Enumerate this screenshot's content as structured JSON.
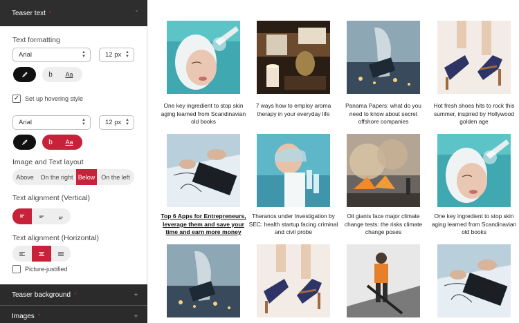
{
  "sidebar": {
    "teaser_text": {
      "title": "Teaser text",
      "required_mark": "*",
      "toggle": "ˇ"
    },
    "text_formatting_label": "Text formatting",
    "font1": {
      "value": "Arial"
    },
    "size1": {
      "value": "12 px"
    },
    "style_bold": "b",
    "style_underline": "Aa",
    "hover_checkbox": {
      "label": "Set up hovering style",
      "checked": true
    },
    "font2": {
      "value": "Arial"
    },
    "size2": {
      "value": "12 px"
    },
    "layout_label": "Image and Text layout",
    "layout_options": [
      "Above",
      "On the right",
      "Below",
      "On the left"
    ],
    "layout_selected": "Below",
    "valign_label": "Text alignment (Vertical)",
    "halign_label": "Text alignment (Horizontal)",
    "picture_justified": {
      "label": "Picture-justified",
      "checked": false
    },
    "teaser_background": {
      "title": "Teaser background",
      "required_mark": "*",
      "toggle": "+"
    },
    "images": {
      "title": "Images",
      "required_mark": "*",
      "toggle": "+"
    },
    "colors": {
      "accent": "#c8213a",
      "dark": "#2b2b2b"
    }
  },
  "tiles": [
    {
      "caption": "One key ingredient to stop skin aging learned from Scandinavian old books",
      "image": "spa-face"
    },
    {
      "caption": "7 ways how to employ aroma therapy in your everyday life",
      "image": "candles"
    },
    {
      "caption": "Panama Papers: what do you need to know about secret offshore companies",
      "image": "city-laptop"
    },
    {
      "caption": "Hot fresh shoes hits to rock this summer, inspired by Hollywood golden age",
      "image": "heels"
    },
    {
      "caption": "Top 6 Apps for Entrepreneurs, leverage them and save your time and earn more money",
      "image": "laptop-desk",
      "emphasis": true
    },
    {
      "caption": "Theranos under Investigation by SEC: health startup facing criminal and civil probe",
      "image": "lab"
    },
    {
      "caption": "Oil giants face major climate change tests: the risks climate change poses",
      "image": "fire"
    },
    {
      "caption": "One key ingredient to stop skin aging learned from Scandinavian old books",
      "image": "spa-face"
    },
    {
      "caption": "",
      "image": "city-laptop"
    },
    {
      "caption": "",
      "image": "heels"
    },
    {
      "caption": "",
      "image": "orange-shirt"
    },
    {
      "caption": "",
      "image": "laptop-desk"
    }
  ]
}
